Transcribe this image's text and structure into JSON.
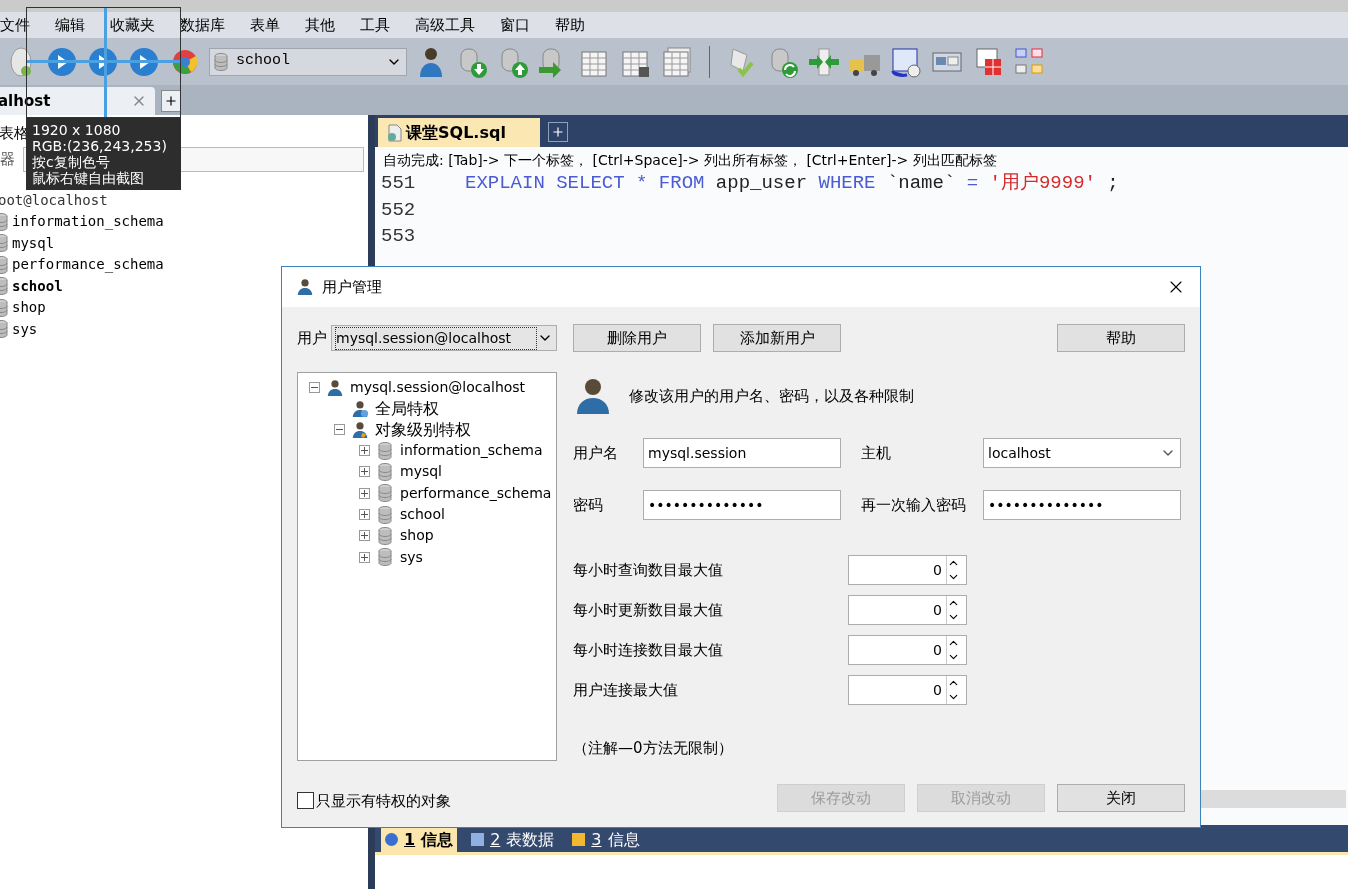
{
  "menu": [
    "文件",
    "编辑",
    "收藏夹",
    "数据库",
    "表单",
    "其他",
    "工具",
    "高级工具",
    "窗口",
    "帮助"
  ],
  "toolbar": {
    "database_select": "school"
  },
  "connection_tab": {
    "label": "alhost"
  },
  "left_panel": {
    "label": "表格",
    "filter_label": "器",
    "root": "oot@localhost",
    "databases": [
      {
        "name": "information_schema",
        "selected": false
      },
      {
        "name": "mysql",
        "selected": false
      },
      {
        "name": "performance_schema",
        "selected": false
      },
      {
        "name": "school",
        "selected": true
      },
      {
        "name": "shop",
        "selected": false
      },
      {
        "name": "sys",
        "selected": false
      }
    ]
  },
  "editor": {
    "tab": "课堂SQL.sql",
    "hint": "自动完成:  [Tab]-> 下一个标签， [Ctrl+Space]-> 列出所有标签， [Ctrl+Enter]-> 列出匹配标签",
    "lines": [
      {
        "number": "551",
        "tokens": [
          {
            "kind": "keyword",
            "text": "EXPLAIN SELECT * FROM"
          },
          {
            "kind": "plain",
            "text": "app_user"
          },
          {
            "kind": "keyword",
            "text": "WHERE"
          },
          {
            "kind": "plain",
            "text": "`name`"
          },
          {
            "kind": "keyword",
            "text": "="
          },
          {
            "kind": "string",
            "text": "'用户9999'"
          },
          {
            "kind": "plain",
            "text": ";"
          }
        ]
      },
      {
        "number": "552"
      },
      {
        "number": "553"
      }
    ]
  },
  "bottom_tabs": [
    {
      "number": "1",
      "label": "信息",
      "selected": true
    },
    {
      "number": "2",
      "label": "表数据",
      "selected": false
    },
    {
      "number": "3",
      "label": "信息",
      "selected": false
    }
  ],
  "capture_tooltip": [
    "1920 x 1080",
    "RGB:(236,243,253)",
    "按c复制色号",
    "鼠标右键自由截图"
  ],
  "dialog": {
    "title": "用户管理",
    "user_label": "用户",
    "user_select": "mysql.session@localhost",
    "top_buttons": [
      "删除用户",
      "添加新用户"
    ],
    "help_button": "帮助",
    "tree": {
      "label": "mysql.session@localhost",
      "expanded": true,
      "children": [
        {
          "label": "全局特权",
          "kind": "global"
        },
        {
          "label": "对象级别特权",
          "kind": "object",
          "expanded": true,
          "children": [
            {
              "label": "information_schema",
              "expanded": false
            },
            {
              "label": "mysql",
              "expanded": false
            },
            {
              "label": "performance_schema",
              "expanded": false
            },
            {
              "label": "school",
              "expanded": false
            },
            {
              "label": "shop",
              "expanded": false
            },
            {
              "label": "sys",
              "expanded": false
            }
          ]
        }
      ]
    },
    "description": "修改该用户的用户名、密码，以及各种限制",
    "username": {
      "label": "用户名",
      "value": "mysql.session"
    },
    "host": {
      "label": "主机",
      "value": "localhost"
    },
    "password": {
      "label": "密码",
      "value": "••••••••••••••"
    },
    "password_repeat": {
      "label": "再一次输入密码",
      "value": "••••••••••••••"
    },
    "limits": [
      {
        "label": "每小时查询数目最大值",
        "value": "0"
      },
      {
        "label": "每小时更新数目最大值",
        "value": "0"
      },
      {
        "label": "每小时连接数目最大值",
        "value": "0"
      },
      {
        "label": "用户连接最大值",
        "value": "0"
      }
    ],
    "note": "（注解—0方法无限制）",
    "only_privileged": {
      "label": "只显示有特权的对象",
      "checked": false
    },
    "bottom_buttons": [
      {
        "label": "保存改动",
        "disabled": true
      },
      {
        "label": "取消改动",
        "disabled": true
      },
      {
        "label": "关闭",
        "disabled": false
      }
    ]
  }
}
